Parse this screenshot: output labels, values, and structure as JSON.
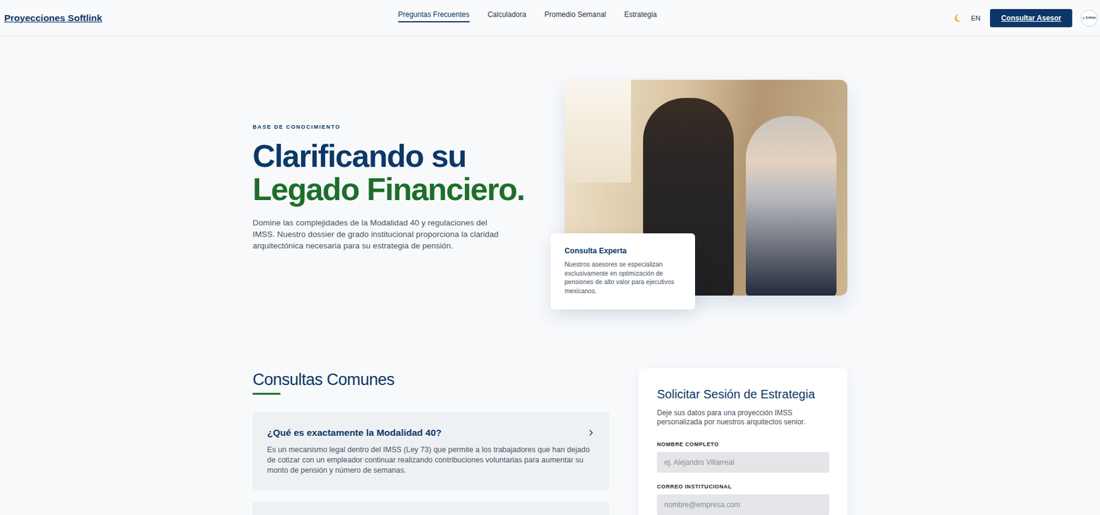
{
  "brand": "Proyecciones Softlink",
  "nav": [
    {
      "label": "Preguntas Frecuentes",
      "selected": true
    },
    {
      "label": "Calculadora",
      "selected": false
    },
    {
      "label": "Promedio Semanal",
      "selected": false
    },
    {
      "label": "Estrategia",
      "selected": false
    }
  ],
  "language": "EN",
  "cta": "Consultar Asesor",
  "avatar": "Softlink",
  "hero": {
    "eyebrow": "BASE DE CONOCIMIENTO",
    "title_line1": "Clarificando su",
    "title_line2": "Legado Financiero.",
    "description": "Domine las complejidades de la Modalidad 40 y regulaciones del IMSS. Nuestro dossier de grado institucional proporciona la claridad arquitectónica necesaria para su estrategia de pensión.",
    "badge": {
      "title": "Consulta Experta",
      "text": "Nuestros asesores se especializan exclusivamente en optimización de pensiones de alto valor para ejecutivos mexicanos."
    }
  },
  "faq": {
    "title": "Consultas Comunes",
    "items": [
      {
        "question": "¿Qué es exactamente la Modalidad 40?",
        "answer": "Es un mecanismo legal dentro del IMSS (Ley 73) que permite a los trabajadores que han dejado de cotizar con un empleador continuar realizando contribuciones voluntarias para aumentar su monto de pensión y número de semanas.",
        "expanded": true
      }
    ]
  },
  "form": {
    "title": "Solicitar Sesión de Estrategia",
    "description": "Deje sus datos para una proyección IMSS personalizada por nuestros arquitectos senior.",
    "fields": [
      {
        "label": "NOMBRE COMPLETO",
        "placeholder": "ej. Alejandro Villarreal"
      },
      {
        "label": "CORREO INSTITUCIONAL",
        "placeholder": "nombre@empresa.com"
      }
    ]
  }
}
